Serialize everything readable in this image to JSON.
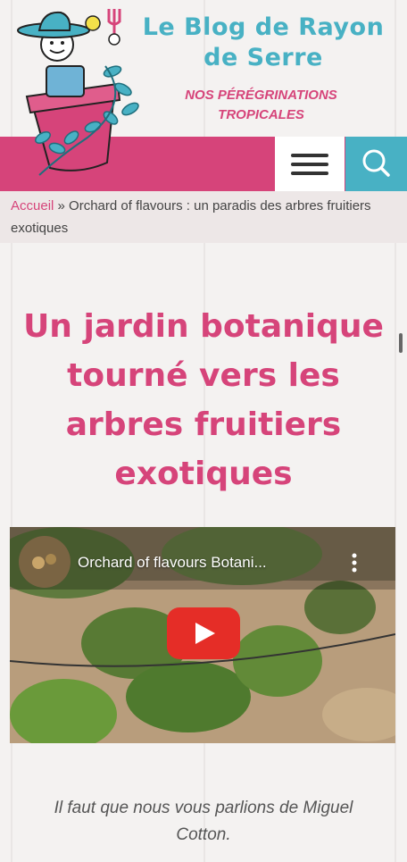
{
  "header": {
    "site_title": "Le Blog de Rayon de Serre",
    "tagline": "NOS PÉRÉGRINATIONS TROPICALES"
  },
  "nav": {
    "menu_icon": "hamburger-icon",
    "search_icon": "search-icon"
  },
  "breadcrumb": {
    "home": "Accueil",
    "separator": "»",
    "current": "Orchard of flavours : un paradis des arbres fruitiers exotiques"
  },
  "article": {
    "headline": "Un jardin botanique tourné vers les arbres fruitiers exotiques",
    "video_title": "Orchard of flavours Botani...",
    "intro": "Il faut que nous vous parlions de Miguel Cotton."
  },
  "colors": {
    "brand_pink": "#d6447a",
    "brand_teal": "#48b1c4",
    "youtube_red": "#e52d27"
  }
}
